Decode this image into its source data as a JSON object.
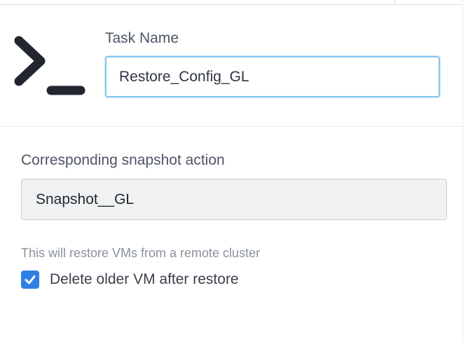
{
  "header": {
    "icon": "terminal-icon"
  },
  "task": {
    "name_label": "Task Name",
    "name_value": "Restore_Config_GL"
  },
  "snapshot": {
    "label": "Corresponding snapshot action",
    "value": "Snapshot__GL"
  },
  "restore": {
    "helper_text": "This will restore VMs from a remote cluster",
    "delete_older_label": "Delete older VM after restore",
    "delete_older_checked": true
  },
  "colors": {
    "accent": "#2f80e4",
    "focus_border": "#89c7ee",
    "icon": "#22262e"
  }
}
